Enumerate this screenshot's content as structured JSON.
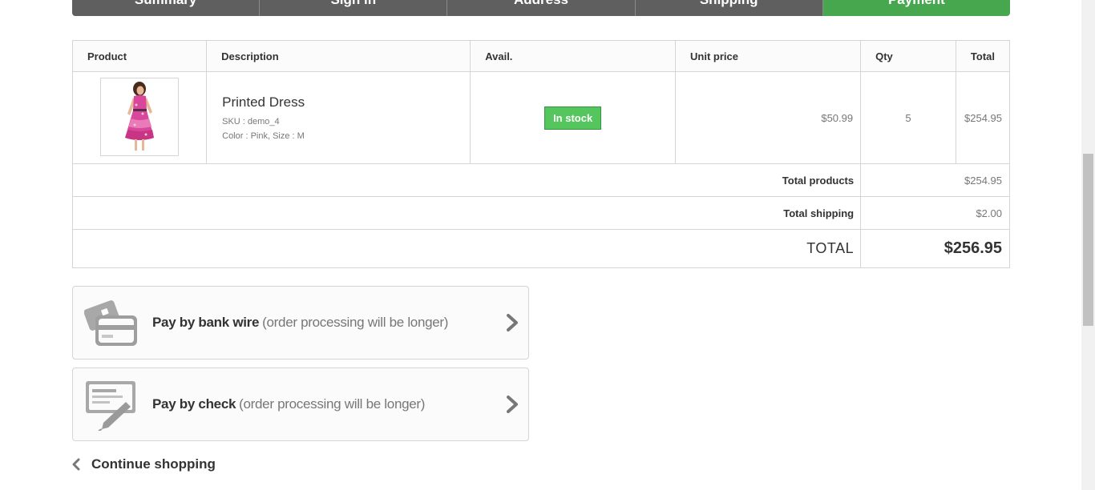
{
  "steps": [
    {
      "label": "Summary",
      "current": false
    },
    {
      "label": "Sign in",
      "current": false
    },
    {
      "label": "Address",
      "current": false
    },
    {
      "label": "Shipping",
      "current": false
    },
    {
      "label": "Payment",
      "current": true
    }
  ],
  "cart": {
    "headers": {
      "product": "Product",
      "description": "Description",
      "avail": "Avail.",
      "unit_price": "Unit price",
      "qty": "Qty",
      "total": "Total"
    },
    "item": {
      "image_icon": "product-photo",
      "name": "Printed Dress",
      "sku": "SKU : demo_4",
      "attributes": "Color : Pink, Size : M",
      "availability": "In stock",
      "unit_price": "$50.99",
      "qty": "5",
      "total": "$254.95"
    },
    "summary": {
      "total_products_label": "Total products",
      "total_products_value": "$254.95",
      "total_shipping_label": "Total shipping",
      "total_shipping_value": "$2.00",
      "total_label": "TOTAL",
      "total_value": "$256.95"
    }
  },
  "payment": {
    "bankwire": {
      "title": "Pay by bank wire",
      "note": "(order processing will be longer)",
      "icon": "bank-card-icon"
    },
    "check": {
      "title": "Pay by check",
      "note": "(order processing will be longer)",
      "icon": "check-pen-icon"
    }
  },
  "continue_label": "Continue shopping",
  "colors": {
    "accent_green": "#46a74e",
    "stock_green": "#55c65e",
    "step_gray": "#5f5f5f",
    "border": "#d6d4d4"
  }
}
